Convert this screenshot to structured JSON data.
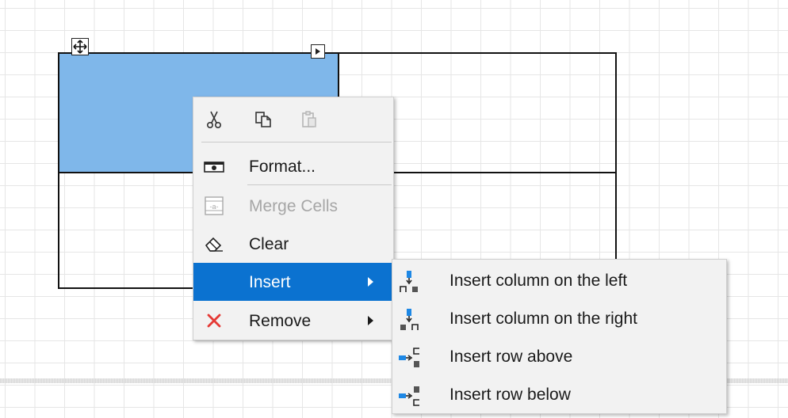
{
  "context_menu": {
    "items": [
      {
        "label": "Format...",
        "icon": "format-icon",
        "enabled": true
      },
      {
        "label": "Merge Cells",
        "icon": "merge-cells-icon",
        "enabled": false
      },
      {
        "label": "Clear",
        "icon": "eraser-icon",
        "enabled": true
      },
      {
        "label": "Insert",
        "icon": "none",
        "enabled": true,
        "highlighted": true,
        "has_submenu": true
      },
      {
        "label": "Remove",
        "icon": "red-x-icon",
        "enabled": true,
        "has_submenu": true
      }
    ],
    "toolbar_icons": [
      "cut-icon",
      "copy-icon",
      "paste-icon"
    ]
  },
  "insert_submenu": {
    "items": [
      {
        "label": "Insert column on the left",
        "icon": "insert-column-left-icon"
      },
      {
        "label": "Insert column on the right",
        "icon": "insert-column-right-icon"
      },
      {
        "label": "Insert row above",
        "icon": "insert-row-above-icon"
      },
      {
        "label": "Insert row below",
        "icon": "insert-row-below-icon"
      }
    ]
  },
  "colors": {
    "selected_cell": "#7fb7ea",
    "highlight": "#0b72d0",
    "remove_icon": "#e53935",
    "icon_blue": "#1e88e5"
  }
}
